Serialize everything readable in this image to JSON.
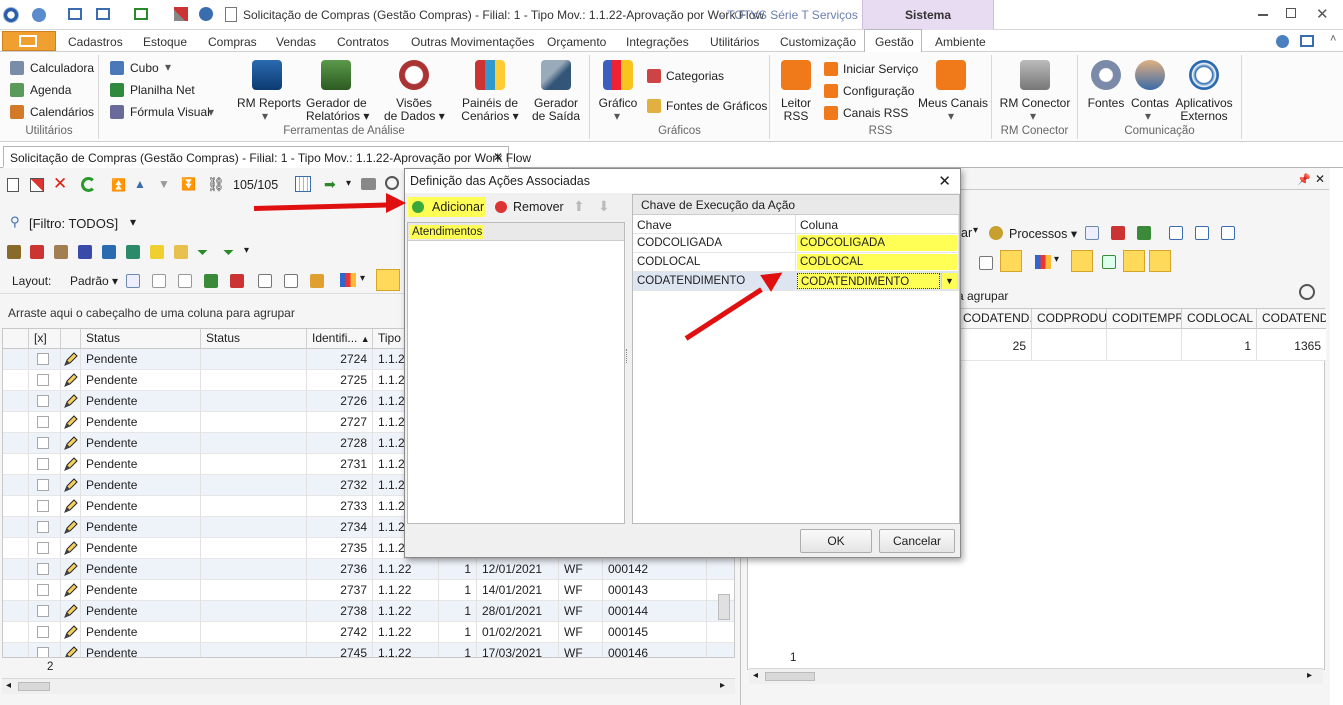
{
  "window": {
    "title": "Solicitação de Compras (Gestão Compras) - Filial: 1 - Tipo Mov.: 1.1.22-Aprovação por Work Flow",
    "title_suffix": "- TOTVS Série T Serviços (R...",
    "context_tab": "Sistema"
  },
  "menu_tabs": [
    "Cadastros",
    "Estoque",
    "Compras",
    "Vendas",
    "Contratos",
    "Outras Movimentações",
    "Orçamento",
    "Integrações",
    "Utilitários",
    "Customização",
    "Gestão",
    "Ambiente"
  ],
  "active_menu_tab": "Gestão",
  "ribbon": {
    "utilitarios": {
      "items": [
        "Calculadora",
        "Agenda",
        "Calendários"
      ],
      "label": "Utilitários"
    },
    "ferramentas": {
      "cubo": "Cubo",
      "planilha": "Planilha Net",
      "formula": "Fórmula Visual",
      "rm_reports": "RM Reports",
      "gerador_rel_1": "Gerador de",
      "gerador_rel_2": "Relatórios",
      "visoes_1": "Visões",
      "visoes_2": "de Dados",
      "paineis_1": "Painéis de",
      "paineis_2": "Cenários",
      "gerador_saida_1": "Gerador",
      "gerador_saida_2": "de Saída",
      "label": "Ferramentas de Análise"
    },
    "graficos": {
      "grafico": "Gráfico",
      "categorias": "Categorias",
      "fontes": "Fontes de Gráficos",
      "label": "Gráficos"
    },
    "rss": {
      "leitor_1": "Leitor",
      "leitor_2": "RSS",
      "iniciar": "Iniciar Serviço",
      "config": "Configuração",
      "canais": "Canais RSS",
      "meus": "Meus Canais",
      "label": "RSS"
    },
    "rm_conector": {
      "btn": "RM Conector",
      "label": "RM Conector"
    },
    "comunicacao": {
      "fontes": "Fontes",
      "contas": "Contas",
      "aplic_1": "Aplicativos",
      "aplic_2": "Externos",
      "label": "Comunicação"
    }
  },
  "doc_tab": "Solicitação de Compras (Gestão Compras) - Filial: 1 - Tipo Mov.: 1.1.22-Aprovação por Work Flow",
  "left": {
    "record_count": "105/105",
    "filter": "[Filtro: TODOS]",
    "layout_label": "Layout:",
    "layout_value": "Padrão",
    "group_hint": "Arraste aqui o cabeçalho de uma coluna para agrupar",
    "columns": [
      "[x]",
      "Status",
      "Status",
      "Identifi...",
      "Tipo d"
    ],
    "rows": [
      {
        "status": "Pendente",
        "id": "2724",
        "tipo": "1.1.22",
        "n": "",
        "date": "",
        "wf": "",
        "num": ""
      },
      {
        "status": "Pendente",
        "id": "2725",
        "tipo": "1.1.22",
        "n": "",
        "date": "",
        "wf": "",
        "num": ""
      },
      {
        "status": "Pendente",
        "id": "2726",
        "tipo": "1.1.22",
        "n": "",
        "date": "",
        "wf": "",
        "num": ""
      },
      {
        "status": "Pendente",
        "id": "2727",
        "tipo": "1.1.22",
        "n": "",
        "date": "",
        "wf": "",
        "num": ""
      },
      {
        "status": "Pendente",
        "id": "2728",
        "tipo": "1.1.22",
        "n": "",
        "date": "",
        "wf": "",
        "num": ""
      },
      {
        "status": "Pendente",
        "id": "2731",
        "tipo": "1.1.22",
        "n": "",
        "date": "",
        "wf": "",
        "num": ""
      },
      {
        "status": "Pendente",
        "id": "2732",
        "tipo": "1.1.22",
        "n": "",
        "date": "",
        "wf": "",
        "num": ""
      },
      {
        "status": "Pendente",
        "id": "2733",
        "tipo": "1.1.22",
        "n": "",
        "date": "",
        "wf": "",
        "num": ""
      },
      {
        "status": "Pendente",
        "id": "2734",
        "tipo": "1.1.22",
        "n": "",
        "date": "",
        "wf": "",
        "num": ""
      },
      {
        "status": "Pendente",
        "id": "2735",
        "tipo": "1.1.22",
        "n": "",
        "date": "",
        "wf": "",
        "num": ""
      },
      {
        "status": "Pendente",
        "id": "2736",
        "tipo": "1.1.22",
        "n": "1",
        "date": "12/01/2021",
        "wf": "WF",
        "num": "000142"
      },
      {
        "status": "Pendente",
        "id": "2737",
        "tipo": "1.1.22",
        "n": "1",
        "date": "14/01/2021",
        "wf": "WF",
        "num": "000143"
      },
      {
        "status": "Pendente",
        "id": "2738",
        "tipo": "1.1.22",
        "n": "1",
        "date": "28/01/2021",
        "wf": "WF",
        "num": "000144"
      },
      {
        "status": "Pendente",
        "id": "2742",
        "tipo": "1.1.22",
        "n": "1",
        "date": "01/02/2021",
        "wf": "WF",
        "num": "000145"
      },
      {
        "status": "Pendente",
        "id": "2745",
        "tipo": "1.1.22",
        "n": "1",
        "date": "17/03/2021",
        "wf": "WF",
        "num": "000146"
      }
    ],
    "footer_count": "2"
  },
  "right": {
    "processos": "Processos",
    "partial_label": "ar",
    "group_hint": "a agrupar",
    "columns": [
      "CODATEND...",
      "CODPRODU...",
      "CODITEMPRD",
      "CODLOCAL",
      "CODATEND..."
    ],
    "row": [
      "25",
      "",
      "",
      "1",
      "1365"
    ],
    "footer_count": "1"
  },
  "dialog": {
    "title": "Definição das Ações Associadas",
    "add": "Adicionar",
    "remove": "Remover",
    "list_item": "Atendimentos",
    "panel_title": "Chave de Execução da Ação",
    "col_chave": "Chave",
    "col_coluna": "Coluna",
    "mappings": [
      {
        "chave": "CODCOLIGADA",
        "coluna": "CODCOLIGADA"
      },
      {
        "chave": "CODLOCAL",
        "coluna": "CODLOCAL"
      },
      {
        "chave": "CODATENDIMENTO",
        "coluna": "CODATENDIMENTO"
      }
    ],
    "ok": "OK",
    "cancel": "Cancelar"
  },
  "colors": {
    "highlight": "#ffff55",
    "arrow": "#e01010",
    "file_tab": "#f0a030",
    "context_tab": "#e8dcf3"
  }
}
